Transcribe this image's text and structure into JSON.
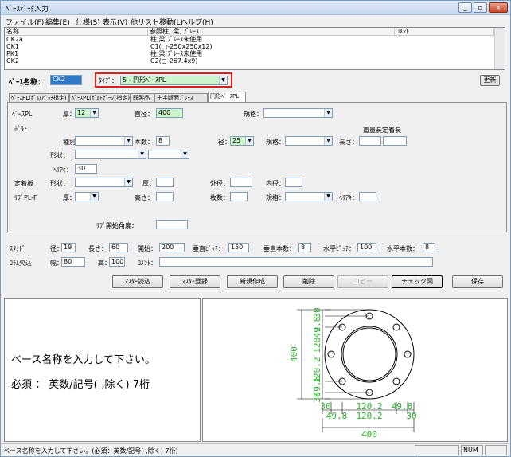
{
  "window": {
    "title": "ﾍﾞｰｽﾃﾞｰﾀ入力"
  },
  "menu": [
    "ファイル(F)",
    "編集(E)",
    "仕様(S)",
    "表示(V)",
    "他リスト移動(L)",
    "ヘルプ(H)"
  ],
  "list": {
    "headers": [
      "名称",
      "参照柱, 梁, ﾌﾞﾚｰｽ",
      "ｺﾒﾝﾄ"
    ],
    "rows": [
      [
        "CK2a",
        "柱,梁,ﾌﾞﾚｰｽ未使用",
        ""
      ],
      [
        "CK1",
        "C1(□-250x250x12)",
        ""
      ],
      [
        "PK1",
        "柱,梁,ﾌﾞﾚｰｽ未使用",
        ""
      ],
      [
        "CK2",
        "C2(○-267.4x9)",
        ""
      ]
    ]
  },
  "base": {
    "name_label": "ﾍﾞｰｽ名称：",
    "name_value": "CK2",
    "type_label": "ﾀｲﾌﾟ：",
    "type_value": "5 - 円形ﾍﾞｰｽPL",
    "update": "更新"
  },
  "tabs": [
    "ﾍﾞｰｽPL(ﾎﾞﾙﾄﾋﾟｯﾁ指定)",
    "ﾍﾞｰｽPL(ﾎﾞﾙﾄｹﾞｰｼﾞ指定)",
    "既製品",
    "十字断面ﾌﾞﾚｰｽ",
    "円形ﾍﾞｰｽPL"
  ],
  "form": {
    "basepl": "ﾍﾞｰｽPL",
    "thick": "厚：",
    "thick_val": "12",
    "dia": "直径：",
    "dia_val": "400",
    "spec": "規格：",
    "bolt": "ﾎﾞﾙﾄ",
    "kind": "種別：",
    "count": "本数：",
    "count_val": "8",
    "diam": "径：",
    "diam_val": "25",
    "spec2": "規格：",
    "extra": "重量長定着長",
    "length": "長さ：",
    "shape": "形状：",
    "herie": "ﾍﾘｱｷ：",
    "herie_val": "30",
    "anchor": "定着板",
    "shape2": "形状：",
    "thick2": "厚：",
    "outer": "外径：",
    "inner": "内径：",
    "rib": "ﾘﾌﾞPL-F",
    "thick3": "厚：",
    "height": "高さ：",
    "num": "枚数：",
    "spec3": "規格：",
    "herie2": "ﾍﾘｱｷ：",
    "ribangle": "ﾘﾌﾞ開始角度："
  },
  "stud": {
    "label": "ｽﾀｯﾄﾞ",
    "dia": "径：",
    "dia_val": "19",
    "len": "長さ：",
    "len_val": "60",
    "start": "開始：",
    "start_val": "200",
    "vpitch": "垂直ﾋﾟｯﾁ：",
    "vpitch_val": "150",
    "vcount": "垂直本数：",
    "vcount_val": "8",
    "hpitch": "水平ﾋﾟｯﾁ：",
    "hpitch_val": "100",
    "hcount": "水平本数：",
    "hcount_val": "8"
  },
  "column": {
    "label": "ｺﾗﾑ欠込",
    "width": "幅：",
    "width_val": "80",
    "height": "高：",
    "height_val": "100",
    "comment": "ｺﾒﾝﾄ："
  },
  "buttons": [
    "ﾏｽﾀｰ読込",
    "ﾏｽﾀｰ登録",
    "新規作成",
    "削除",
    "コピー",
    "チェック図",
    "保存"
  ],
  "message": {
    "line1": "ベース名称を入力して下さい。",
    "line2": "必須 ： 英数/記号(-,除く) 7桁"
  },
  "drawing": {
    "dim400": "400",
    "d30": "30",
    "d498": "49.8",
    "d1202": "120.2"
  },
  "status": {
    "text": "ベース名称を入力して下さい。(必須：英数/記号(-,除く) 7桁)",
    "num": "NUM"
  },
  "colors": {
    "green": "#2db32d",
    "highlight": "#e0201c"
  }
}
